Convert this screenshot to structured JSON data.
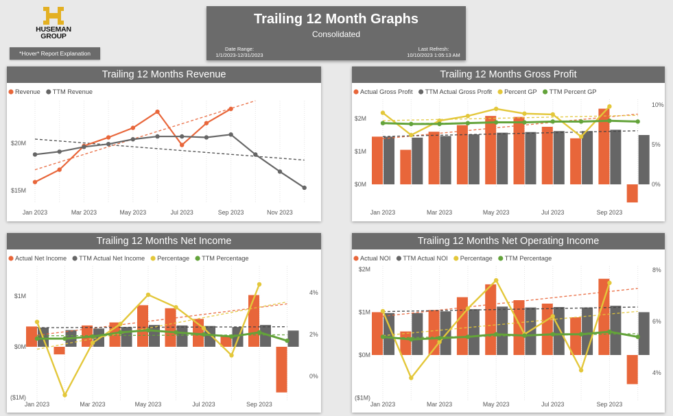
{
  "logo": {
    "name": "HUSEMAN GROUP"
  },
  "hover_button": {
    "label": "*Hover* Report Explanation"
  },
  "header": {
    "title": "Trailing 12 Month Graphs",
    "subtitle": "Consolidated",
    "date_range_label": "Date Range:",
    "date_range_value": "1/1/2023-12/31/2023",
    "last_refresh_label": "Last Refresh:",
    "last_refresh_value": "10/10/2023 1:05:13 AM"
  },
  "colors": {
    "orange": "#e8663a",
    "gray": "#666666",
    "yellow": "#e3c73a",
    "green": "#63a33a",
    "header_bg": "#6b6b6b"
  },
  "chart_data": [
    {
      "id": "revenue",
      "type": "line",
      "title": "Trailing 12 Months Revenue",
      "x_tick_labels": [
        "Jan 2023",
        "Mar 2023",
        "May 2023",
        "Jul 2023",
        "Sep 2023",
        "Nov 2023"
      ],
      "y_tick_labels": [
        "$20M",
        "$15M"
      ],
      "legend": [
        "Revenue",
        "TTM Revenue"
      ],
      "series": [
        {
          "name": "Revenue",
          "values": [
            15.9,
            17.2,
            19.7,
            20.6,
            21.6,
            23.3,
            19.8,
            22.1,
            23.6
          ]
        },
        {
          "name": "TTM Revenue",
          "values": [
            18.8,
            19.1,
            19.6,
            19.9,
            20.4,
            20.7,
            20.7,
            20.6,
            20.9,
            18.8,
            17.0,
            15.3
          ]
        }
      ],
      "trend_lines": true
    },
    {
      "id": "gross_profit",
      "type": "combo",
      "title": "Trailing 12 Months Gross Profit",
      "x_tick_labels": [
        "Jan 2023",
        "Mar 2023",
        "May 2023",
        "Jul 2023",
        "Sep 2023"
      ],
      "y_tick_labels": [
        "$2M",
        "$1M",
        "$0M"
      ],
      "y2_tick_labels": [
        "10%",
        "5%",
        "0%"
      ],
      "legend": [
        "Actual Gross Profit",
        "TTM Actual Gross Profit",
        "Percent GP",
        "TTM Percent GP"
      ],
      "series": [
        {
          "name": "Actual Gross Profit",
          "values": [
            1.45,
            1.05,
            1.6,
            1.8,
            2.08,
            2.05,
            1.75,
            1.4,
            2.3,
            -0.55
          ]
        },
        {
          "name": "TTM Actual Gross Profit",
          "values": [
            1.45,
            1.42,
            1.47,
            1.52,
            1.57,
            1.59,
            1.62,
            1.62,
            1.66,
            1.5
          ]
        },
        {
          "name": "Percent GP",
          "values": [
            9.0,
            6.2,
            8.0,
            8.6,
            9.5,
            8.9,
            8.8,
            6.0,
            9.8
          ]
        },
        {
          "name": "TTM Percent GP",
          "values": [
            7.7,
            7.6,
            7.6,
            7.7,
            7.8,
            7.8,
            7.9,
            7.9,
            8.0,
            7.9
          ]
        }
      ],
      "trend_lines": true
    },
    {
      "id": "net_income",
      "type": "combo",
      "title": "Trailing 12 Months Net Income",
      "x_tick_labels": [
        "Jan 2023",
        "Mar 2023",
        "May 2023",
        "Jul 2023",
        "Sep 2023"
      ],
      "y_tick_labels": [
        "$1M",
        "$0M",
        "($1M)"
      ],
      "y2_tick_labels": [
        "4%",
        "2%",
        "0%"
      ],
      "legend": [
        "Actual Net Income",
        "TTM Actual Net Income",
        "Percentage",
        "TTM Percentage"
      ],
      "series": [
        {
          "name": "Actual Net Income",
          "values": [
            0.4,
            -0.15,
            0.42,
            0.48,
            0.82,
            0.76,
            0.55,
            0.22,
            1.02,
            -0.9
          ]
        },
        {
          "name": "TTM Actual Net Income",
          "values": [
            0.38,
            0.33,
            0.36,
            0.39,
            0.43,
            0.42,
            0.41,
            0.39,
            0.43,
            0.32
          ]
        },
        {
          "name": "Percentage",
          "values": [
            2.6,
            -0.9,
            1.6,
            2.5,
            3.9,
            3.3,
            2.3,
            1.0,
            4.4
          ]
        },
        {
          "name": "TTM Percentage",
          "values": [
            1.8,
            1.8,
            1.9,
            2.1,
            2.2,
            2.1,
            2.0,
            1.9,
            2.1,
            1.7
          ]
        }
      ],
      "trend_lines": true
    },
    {
      "id": "noi",
      "type": "combo",
      "title": "Trailing 12 Months Net Operating Income",
      "x_tick_labels": [
        "Jan 2023",
        "Mar 2023",
        "May 2023",
        "Jul 2023",
        "Sep 2023"
      ],
      "y_tick_labels": [
        "$2M",
        "$1M",
        "$0M",
        "($1M)"
      ],
      "y2_tick_labels": [
        "8%",
        "6%",
        "4%"
      ],
      "legend": [
        "Actual NOI",
        "TTM Actual NOI",
        "Percentage",
        "TTM Percentage"
      ],
      "series": [
        {
          "name": "Actual NOI",
          "values": [
            1.0,
            0.55,
            1.05,
            1.35,
            1.65,
            1.28,
            1.2,
            0.88,
            1.78,
            -0.68
          ]
        },
        {
          "name": "TTM Actual NOI",
          "values": [
            0.98,
            0.98,
            1.02,
            1.07,
            1.13,
            1.11,
            1.12,
            1.11,
            1.15,
            1.0
          ]
        },
        {
          "name": "Percentage",
          "values": [
            6.4,
            3.8,
            5.2,
            6.5,
            7.6,
            5.5,
            6.2,
            4.1,
            7.5
          ]
        },
        {
          "name": "TTM Percentage",
          "values": [
            5.4,
            5.3,
            5.35,
            5.4,
            5.5,
            5.45,
            5.5,
            5.5,
            5.6,
            5.4
          ]
        }
      ],
      "trend_lines": true
    }
  ]
}
